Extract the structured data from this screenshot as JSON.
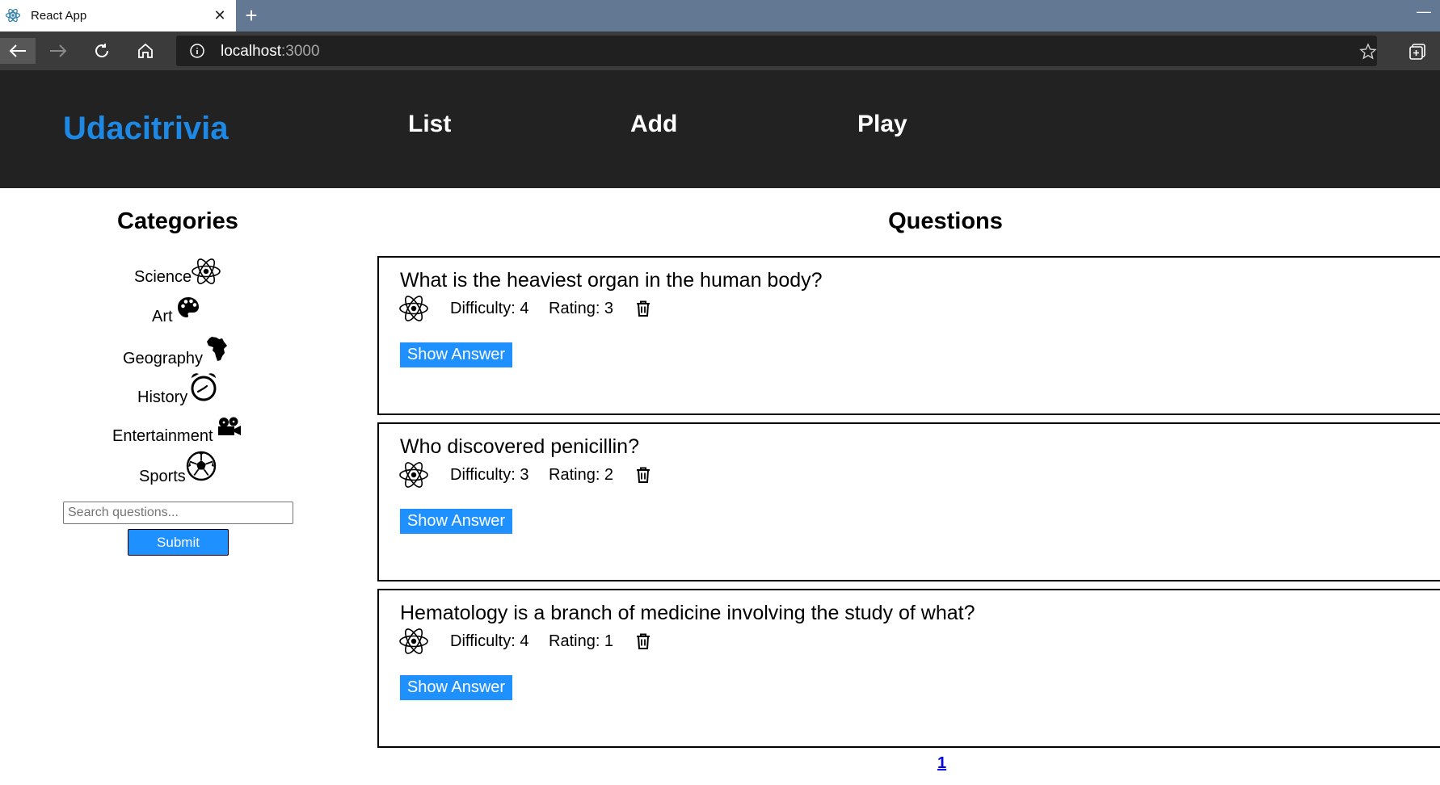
{
  "browser": {
    "tab_title": "React App",
    "tab_close": "✕",
    "new_tab": "+",
    "minimize": "—",
    "address_host": "localhost",
    "address_port": ":3000"
  },
  "header": {
    "brand": "Udacitrivia",
    "nav": [
      {
        "label": "List"
      },
      {
        "label": "Add"
      },
      {
        "label": "Play"
      }
    ]
  },
  "sidebar": {
    "title": "Categories",
    "categories": [
      {
        "label": "Science",
        "icon": "atom-icon"
      },
      {
        "label": "Art",
        "icon": "palette-icon"
      },
      {
        "label": "Geography",
        "icon": "africa-icon"
      },
      {
        "label": "History",
        "icon": "alarm-clock-icon"
      },
      {
        "label": "Entertainment",
        "icon": "film-camera-icon"
      },
      {
        "label": "Sports",
        "icon": "soccer-ball-icon"
      }
    ],
    "search": {
      "placeholder": "Search questions...",
      "value": ""
    },
    "submit_label": "Submit"
  },
  "main": {
    "title": "Questions",
    "questions": [
      {
        "text": "What is the heaviest organ in the human body?",
        "difficulty": "Difficulty: 4",
        "rating": "Rating: 3",
        "category_icon": "atom-icon",
        "show_answer": "Show Answer"
      },
      {
        "text": "Who discovered penicillin?",
        "difficulty": "Difficulty: 3",
        "rating": "Rating: 2",
        "category_icon": "atom-icon",
        "show_answer": "Show Answer"
      },
      {
        "text": "Hematology is a branch of medicine involving the study of what?",
        "difficulty": "Difficulty: 4",
        "rating": "Rating: 1",
        "category_icon": "atom-icon",
        "show_answer": "Show Answer"
      }
    ],
    "pagination": {
      "current": "1"
    }
  },
  "colors": {
    "brand": "#1e88e5",
    "header_bg": "#222222",
    "button_blue": "#1e90ff",
    "chrome_bg": "#637993"
  }
}
